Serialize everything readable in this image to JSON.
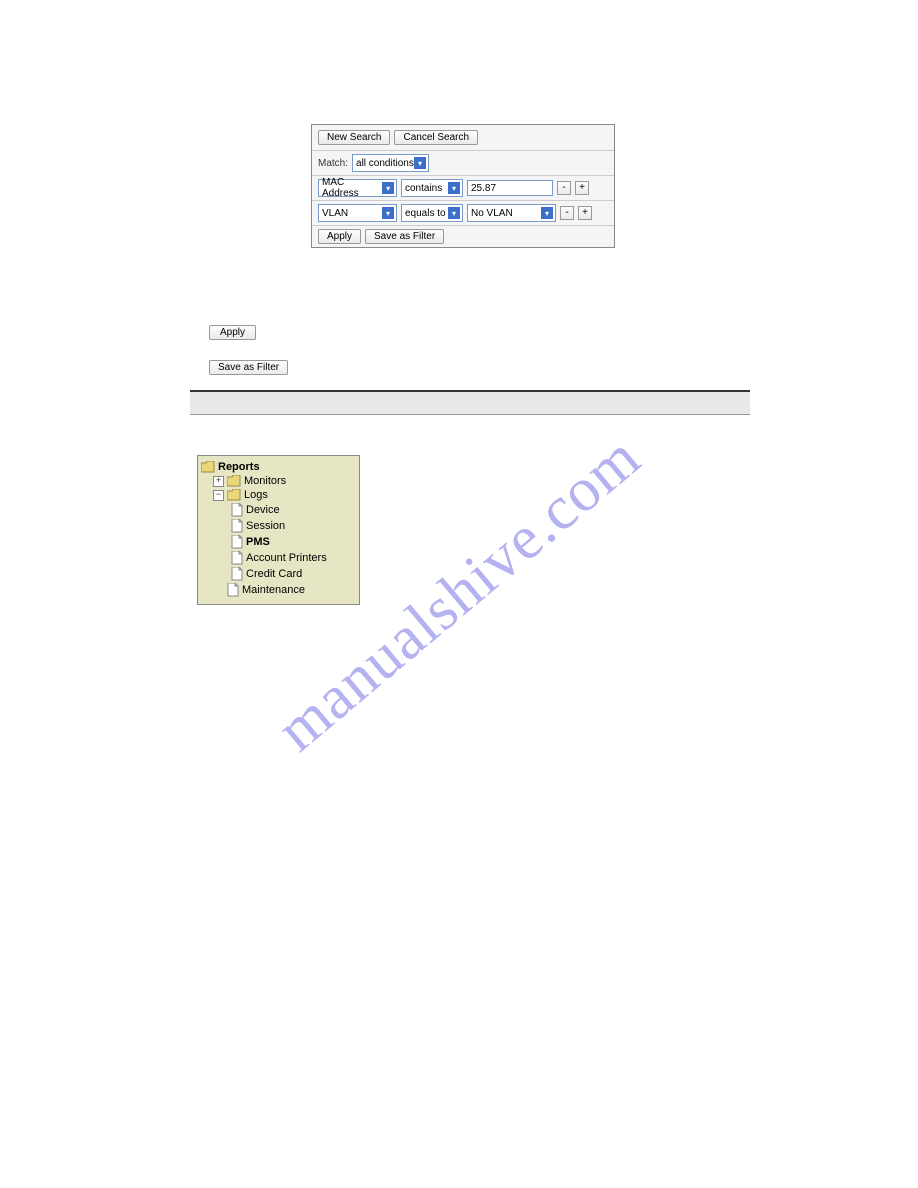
{
  "watermark": "manualshive.com",
  "searchPanel": {
    "newSearch": "New Search",
    "cancelSearch": "Cancel Search",
    "matchLabel": "Match:",
    "matchValue": "all conditions",
    "row1": {
      "field": "MAC Address",
      "op": "contains",
      "value": "25.87",
      "minus": "-",
      "plus": "+"
    },
    "row2": {
      "field": "VLAN",
      "op": "equals to",
      "value": "No VLAN",
      "minus": "-",
      "plus": "+"
    },
    "apply": "Apply",
    "saveAsFilter": "Save as Filter"
  },
  "standalone": {
    "apply": "Apply",
    "saveAsFilter": "Save as Filter"
  },
  "tree": {
    "reports": "Reports",
    "monitors": "Monitors",
    "logs": "Logs",
    "device": "Device",
    "session": "Session",
    "pms": "PMS",
    "accountPrinters": "Account Printers",
    "creditCard": "Credit Card",
    "maintenance": "Maintenance",
    "plus": "+",
    "minus": "−"
  }
}
